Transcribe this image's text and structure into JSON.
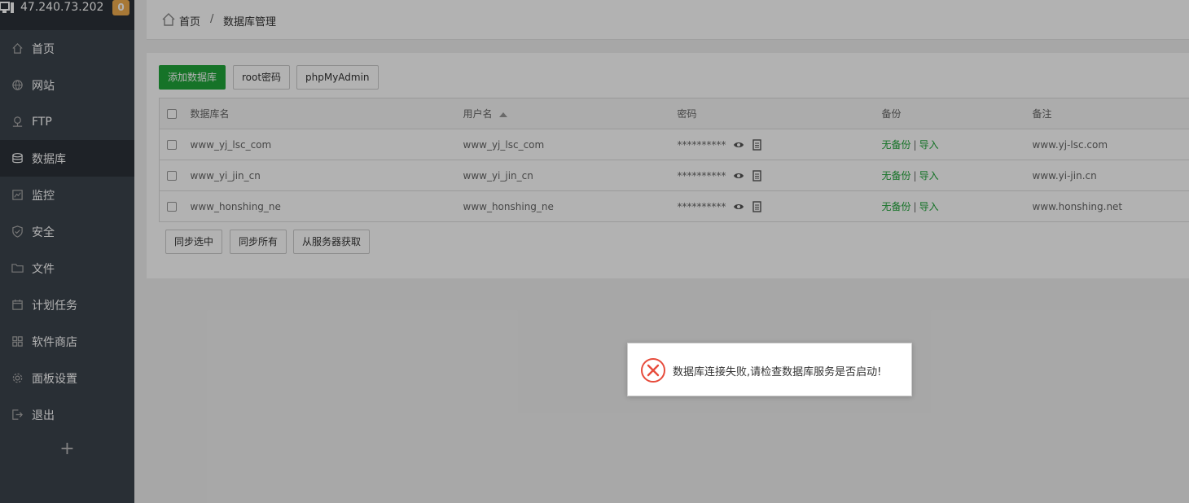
{
  "sidebar": {
    "ip": "47.240.73.202",
    "badge": "0",
    "items": [
      {
        "label": "首页",
        "icon": "home-icon"
      },
      {
        "label": "网站",
        "icon": "globe-icon"
      },
      {
        "label": "FTP",
        "icon": "ftp-icon"
      },
      {
        "label": "数据库",
        "icon": "database-icon",
        "active": true
      },
      {
        "label": "监控",
        "icon": "chart-icon"
      },
      {
        "label": "安全",
        "icon": "shield-icon"
      },
      {
        "label": "文件",
        "icon": "folder-icon"
      },
      {
        "label": "计划任务",
        "icon": "calendar-icon"
      },
      {
        "label": "软件商店",
        "icon": "grid-icon"
      },
      {
        "label": "面板设置",
        "icon": "gear-icon"
      },
      {
        "label": "退出",
        "icon": "logout-icon"
      }
    ],
    "add": "+"
  },
  "breadcrumb": {
    "home": "首页",
    "sep": "/",
    "current": "数据库管理"
  },
  "toolbar": {
    "add_db": "添加数据库",
    "root_pwd": "root密码",
    "phpmyadmin": "phpMyAdmin"
  },
  "table": {
    "headers": {
      "name": "数据库名",
      "user": "用户名",
      "password": "密码",
      "backup": "备份",
      "note": "备注"
    },
    "rows": [
      {
        "name": "www_yj_lsc_com",
        "user": "www_yj_lsc_com",
        "password": "**********",
        "backup": "无备份",
        "import": "导入",
        "note": "www.yj-lsc.com"
      },
      {
        "name": "www_yi_jin_cn",
        "user": "www_yi_jin_cn",
        "password": "**********",
        "backup": "无备份",
        "import": "导入",
        "note": "www.yi-jin.cn"
      },
      {
        "name": "www_honshing_ne",
        "user": "www_honshing_ne",
        "password": "**********",
        "backup": "无备份",
        "import": "导入",
        "note": "www.honshing.net"
      }
    ]
  },
  "bottom_buttons": {
    "sync_selected": "同步选中",
    "sync_all": "同步所有",
    "fetch_server": "从服务器获取"
  },
  "toast": {
    "message": "数据库连接失败,请检查数据库服务是否启动!"
  },
  "colors": {
    "sidebar_bg": "#3c444d",
    "accent_green": "#20a53a",
    "badge_orange": "#f0ad4e",
    "error_red": "#e74c3c"
  }
}
